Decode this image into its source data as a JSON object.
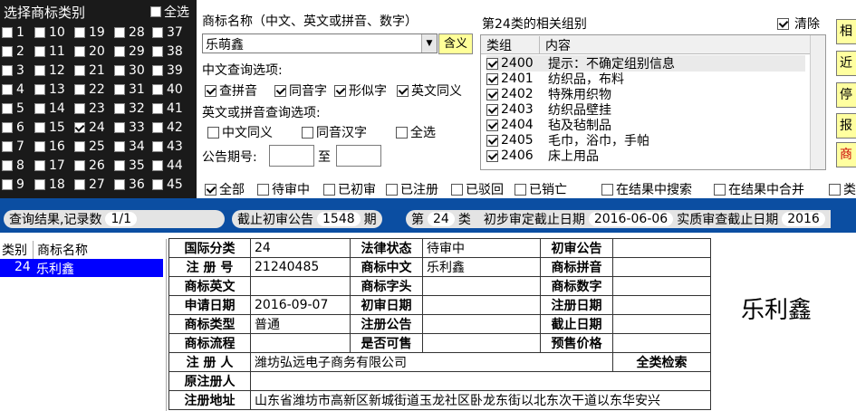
{
  "left_panel": {
    "title": "选择商标类别",
    "select_all": "全选",
    "columns": [
      [
        "1",
        "2",
        "3",
        "4",
        "5",
        "6",
        "7",
        "8",
        "9"
      ],
      [
        "10",
        "11",
        "12",
        "13",
        "14",
        "15",
        "16",
        "17",
        "18"
      ],
      [
        "19",
        "20",
        "21",
        "22",
        "23",
        "24",
        "25",
        "26",
        "27"
      ],
      [
        "28",
        "29",
        "30",
        "31",
        "32",
        "33",
        "34",
        "35",
        "36"
      ],
      [
        "37",
        "38",
        "39",
        "40",
        "41",
        "42",
        "43",
        "44",
        "45"
      ]
    ],
    "checked": "24"
  },
  "search": {
    "name_label": "商标名称（中文、英文或拼音、数字）",
    "name_value": "乐萌鑫",
    "meaning_button": "含义",
    "cn_options_label": "中文查询选项:",
    "cn_options": [
      "查拼音",
      "同音字",
      "形似字",
      "英文同义"
    ],
    "en_options_label": "英文或拼音查询选项:",
    "en_options": [
      "中文同义",
      "同音汉字",
      "全选"
    ],
    "issue_label": "公告期号:",
    "issue_to": "至"
  },
  "groups": {
    "title": "第24类的相关组别",
    "clear": "清除",
    "col_group": "类组",
    "col_content": "内容",
    "rows": [
      {
        "code": "2400",
        "text": "提示：不确定组别信息"
      },
      {
        "code": "2401",
        "text": "纺织品，布料"
      },
      {
        "code": "2402",
        "text": "特殊用织物"
      },
      {
        "code": "2403",
        "text": "纺织品壁挂"
      },
      {
        "code": "2404",
        "text": "毡及毡制品"
      },
      {
        "code": "2405",
        "text": "毛巾，浴巾，手帕"
      },
      {
        "code": "2406",
        "text": "床上用品"
      }
    ]
  },
  "right_buttons": [
    "相",
    "近",
    "停",
    "报",
    "商"
  ],
  "filters": [
    "全部",
    "待审中",
    "已初审",
    "已注册",
    "已驳回",
    "已销亡",
    "在结果中搜索",
    "在结果中合并",
    "类"
  ],
  "status": {
    "results_label": "查询结果,记录数",
    "results_value": "1/1",
    "cutoff_label": "截止初审公告",
    "cutoff_value": "1548",
    "cutoff_unit": "期",
    "class_prefix": "第",
    "class_value": "24",
    "class_suffix": "类",
    "prelim_label": "初步审定截止日期",
    "prelim_value": "2016-06-06",
    "substantive_label": "实质审查截止日期",
    "substantive_value": "2016"
  },
  "list": {
    "col_class": "类别",
    "col_name": "商标名称",
    "selected_class": "24",
    "selected_name": "乐利鑫"
  },
  "detail": {
    "intl_class_k": "国际分类",
    "intl_class_v": "24",
    "legal_status_k": "法律状态",
    "legal_status_v": "待审中",
    "prelim_notice_k": "初审公告",
    "prelim_notice_v": "",
    "reg_no_k": "注 册 号",
    "reg_no_v": "21240485",
    "mark_cn_k": "商标中文",
    "mark_cn_v": "乐利鑫",
    "mark_pinyin_k": "商标拼音",
    "mark_pinyin_v": "",
    "mark_en_k": "商标英文",
    "mark_en_v": "",
    "mark_initials_k": "商标字头",
    "mark_initials_v": "",
    "mark_digits_k": "商标数字",
    "mark_digits_v": "",
    "apply_date_k": "申请日期",
    "apply_date_v": "2016-09-07",
    "prelim_date_k": "初审日期",
    "prelim_date_v": "",
    "reg_date_k": "注册日期",
    "reg_date_v": "",
    "mark_type_k": "商标类型",
    "mark_type_v": "普通",
    "reg_notice_k": "注册公告",
    "reg_notice_v": "",
    "expiry_k": "截止日期",
    "expiry_v": "",
    "flow_k": "商标流程",
    "flow_v": "",
    "sellable_k": "是否可售",
    "sellable_v": "",
    "price_k": "预售价格",
    "price_v": "",
    "registrant_k": "注 册 人",
    "registrant_v": "潍坊弘远电子商务有限公司",
    "all_class_search": "全类检索",
    "orig_registrant_k": "原注册人",
    "orig_registrant_v": "",
    "address_k": "注册地址",
    "address_v": "山东省潍坊市高新区新城街道玉龙社区卧龙东街以北东次干道以东华安兴"
  },
  "preview_name": "乐利鑫"
}
